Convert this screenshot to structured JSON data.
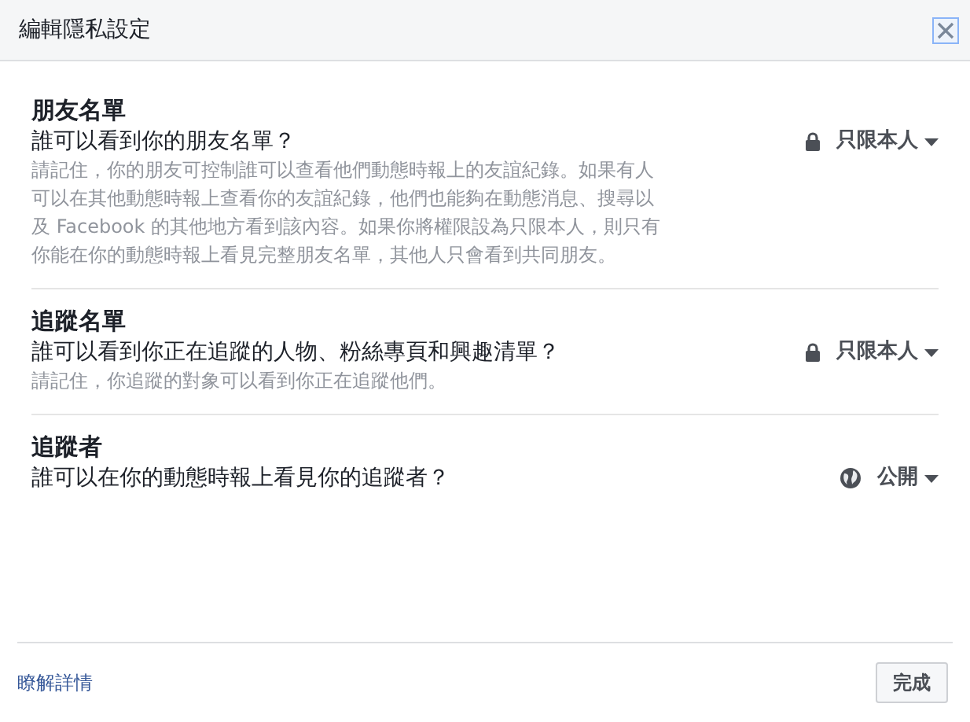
{
  "window": {
    "title": "編輯隱私設定"
  },
  "sections": [
    {
      "title": "朋友名單",
      "question": "誰可以看到你的朋友名單？",
      "note": "請記住，你的朋友可控制誰可以查看他們動態時報上的友誼紀錄。如果有人可以在其他動態時報上查看你的友誼紀錄，他們也能夠在動態消息、搜尋以及 Facebook 的其他地方看到該內容。如果你將權限設為只限本人，則只有你能在你的動態時報上看見完整朋友名單，其他人只會看到共同朋友。",
      "audience": {
        "kind": "lock",
        "label": "只限本人"
      }
    },
    {
      "title": "追蹤名單",
      "question": "誰可以看到你正在追蹤的人物、粉絲專頁和興趣清單？",
      "note": "請記住，你追蹤的對象可以看到你正在追蹤他們。",
      "audience": {
        "kind": "lock",
        "label": "只限本人"
      }
    },
    {
      "title": "追蹤者",
      "question": "誰可以在你的動態時報上看見你的追蹤者？",
      "audience": {
        "kind": "globe",
        "label": "公開"
      }
    }
  ],
  "footer": {
    "link": "瞭解詳情",
    "button": "完成"
  }
}
